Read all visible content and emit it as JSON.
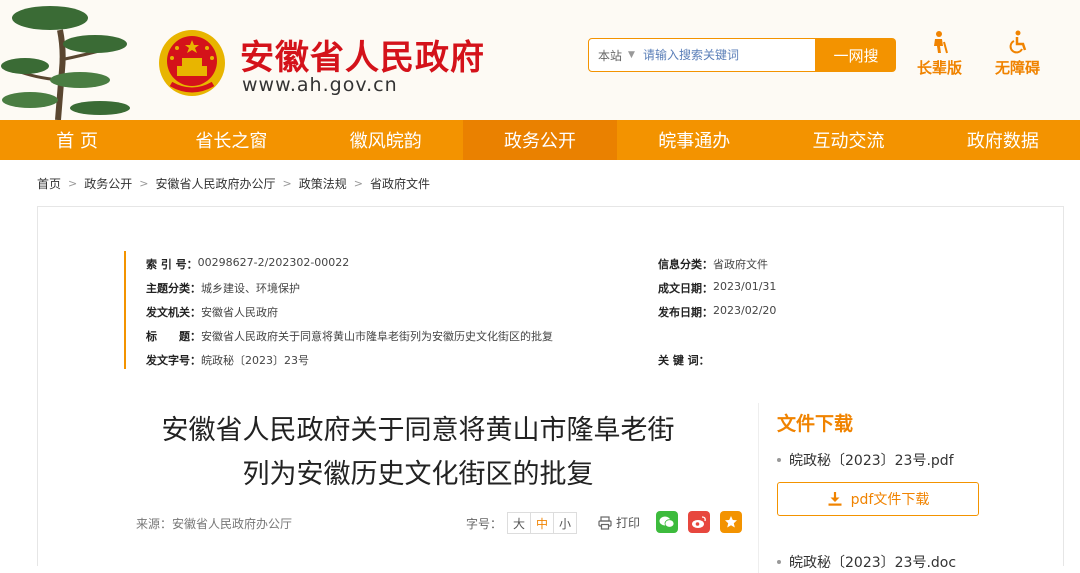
{
  "site": {
    "title": "安徽省人民政府",
    "url": "www.ah.gov.cn"
  },
  "search": {
    "scope": "本站",
    "placeholder": "请输入搜索关键词",
    "button": "一网搜"
  },
  "tools": {
    "elder": "长辈版",
    "accessible": "无障碍"
  },
  "nav": [
    "首 页",
    "省长之窗",
    "徽风皖韵",
    "政务公开",
    "皖事通办",
    "互动交流",
    "政府数据"
  ],
  "nav_active": "政务公开",
  "breadcrumb": [
    "首页",
    "政务公开",
    "安徽省人民政府办公厅",
    "政策法规",
    "省政府文件"
  ],
  "meta": {
    "index_label": "索 引 号：",
    "index_value": "00298627-2/202302-00022",
    "category_label": "信息分类：",
    "category_value": "省政府文件",
    "topic_label": "主题分类：",
    "topic_value": "城乡建设、环境保护",
    "created_label": "成文日期：",
    "created_value": "2023/01/31",
    "issuer_label": "发文机关：",
    "issuer_value": "安徽省人民政府",
    "published_label": "发布日期：",
    "published_value": "2023/02/20",
    "title_label": "标　　题：",
    "title_value": "安徽省人民政府关于同意将黄山市隆阜老街列为安徽历史文化街区的批复",
    "docno_label": "发文字号：",
    "docno_value": "皖政秘〔2023〕23号",
    "keywords_label": "关 键 词："
  },
  "document": {
    "title_line1": "安徽省人民政府关于同意将黄山市隆阜老街",
    "title_line2": "列为安徽历史文化街区的批复",
    "source": "来源：安徽省人民政府办公厅"
  },
  "font_size": {
    "label": "字号：",
    "large": "大",
    "medium": "中",
    "small": "小"
  },
  "print_label": "打印",
  "downloads": {
    "title": "文件下载",
    "pdf_file": "皖政秘〔2023〕23号.pdf",
    "pdf_button": "pdf文件下载",
    "doc_file": "皖政秘〔2023〕23号.doc"
  },
  "colors": {
    "brand_red": "#d4121a",
    "accent_orange": "#f39300"
  }
}
